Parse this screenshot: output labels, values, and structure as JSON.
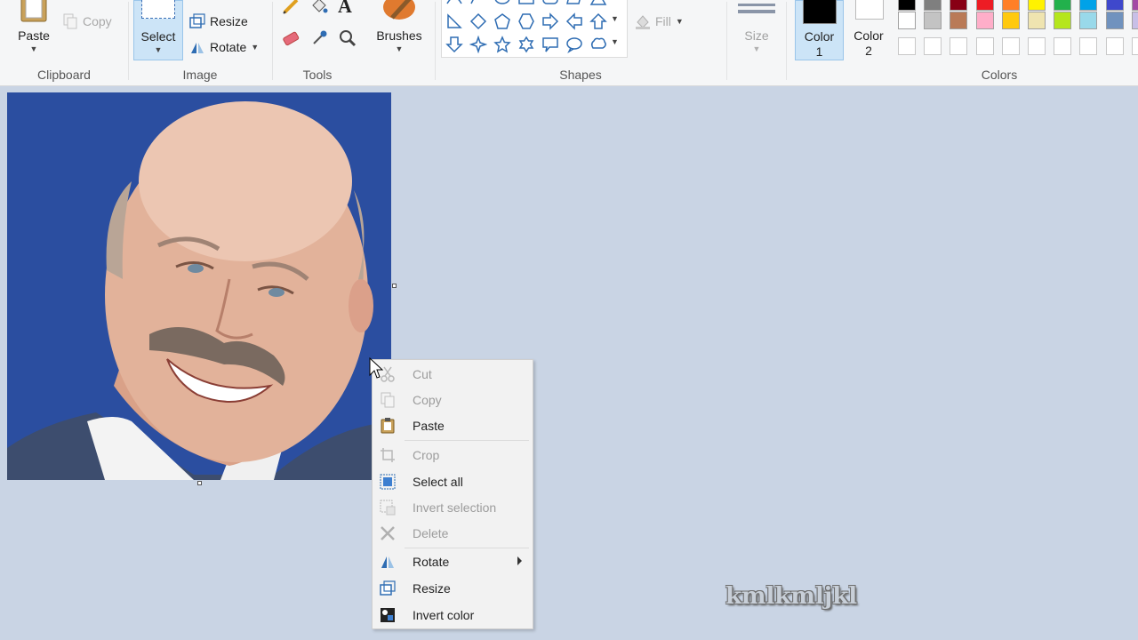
{
  "ribbon": {
    "clipboard": {
      "paste": "Paste",
      "copy": "Copy",
      "group": "Clipboard"
    },
    "image": {
      "select": "Select",
      "resize": "Resize",
      "rotate": "Rotate",
      "group": "Image"
    },
    "tools": {
      "group": "Tools"
    },
    "brushes": {
      "label": "Brushes"
    },
    "shapes": {
      "fill": "Fill",
      "group": "Shapes"
    },
    "size": {
      "label": "Size"
    },
    "color1": {
      "line1": "Color",
      "line2": "1"
    },
    "color2": {
      "line1": "Color",
      "line2": "2"
    },
    "colors": {
      "group": "Colors",
      "row1": [
        "#000000",
        "#7f7f7f",
        "#880015",
        "#ed1c24",
        "#ff7f27",
        "#fff200",
        "#22b14c",
        "#00a2e8",
        "#3f48cc",
        "#a349a4"
      ],
      "row2": [
        "#ffffff",
        "#c3c3c3",
        "#b97a57",
        "#ffaec9",
        "#ffc90e",
        "#efe4b0",
        "#b5e61d",
        "#99d9ea",
        "#7092be",
        "#c8bfe7"
      ]
    }
  },
  "context_menu": {
    "cut": "Cut",
    "copy": "Copy",
    "paste": "Paste",
    "crop": "Crop",
    "select_all": "Select all",
    "invert_selection": "Invert selection",
    "delete": "Delete",
    "rotate": "Rotate",
    "resize": "Resize",
    "invert_color": "Invert color"
  },
  "watermark": "kmlkmljkl"
}
